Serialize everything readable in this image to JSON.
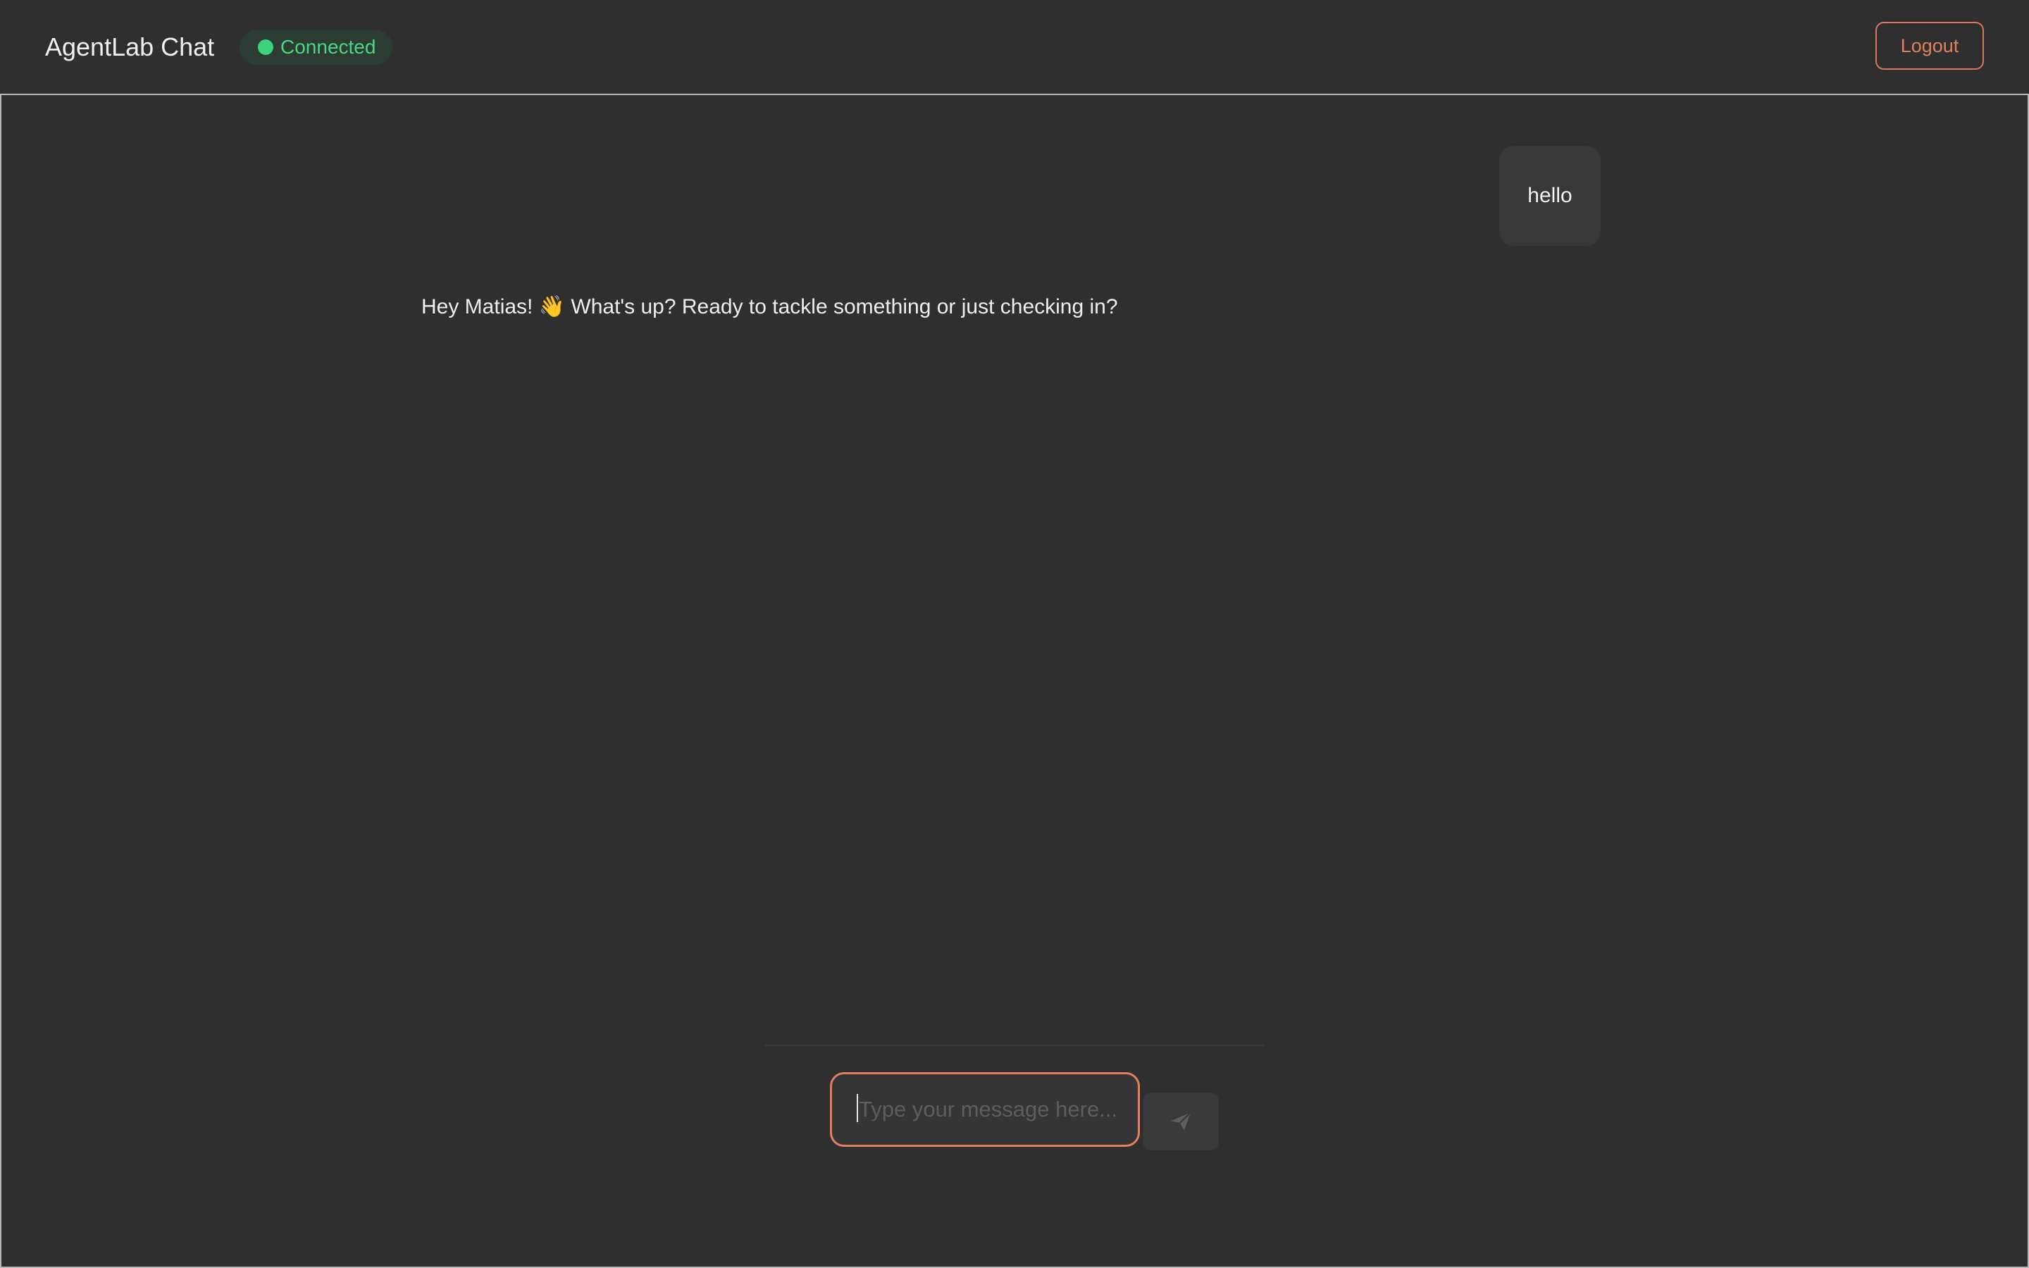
{
  "header": {
    "title": "AgentLab Chat",
    "status": {
      "label": "Connected",
      "color": "#3ed27b"
    },
    "logout_label": "Logout"
  },
  "messages": [
    {
      "role": "user",
      "text": "hello"
    },
    {
      "role": "assistant",
      "text": "Hey Matias! 👋 What's up? Ready to tackle something or just checking in?"
    }
  ],
  "composer": {
    "value": "",
    "placeholder": "Type your message here...",
    "send_icon": "send-icon"
  },
  "theme": {
    "accent": "#e0805f",
    "background": "#2f2f2f",
    "status_green": "#3ed27b"
  }
}
